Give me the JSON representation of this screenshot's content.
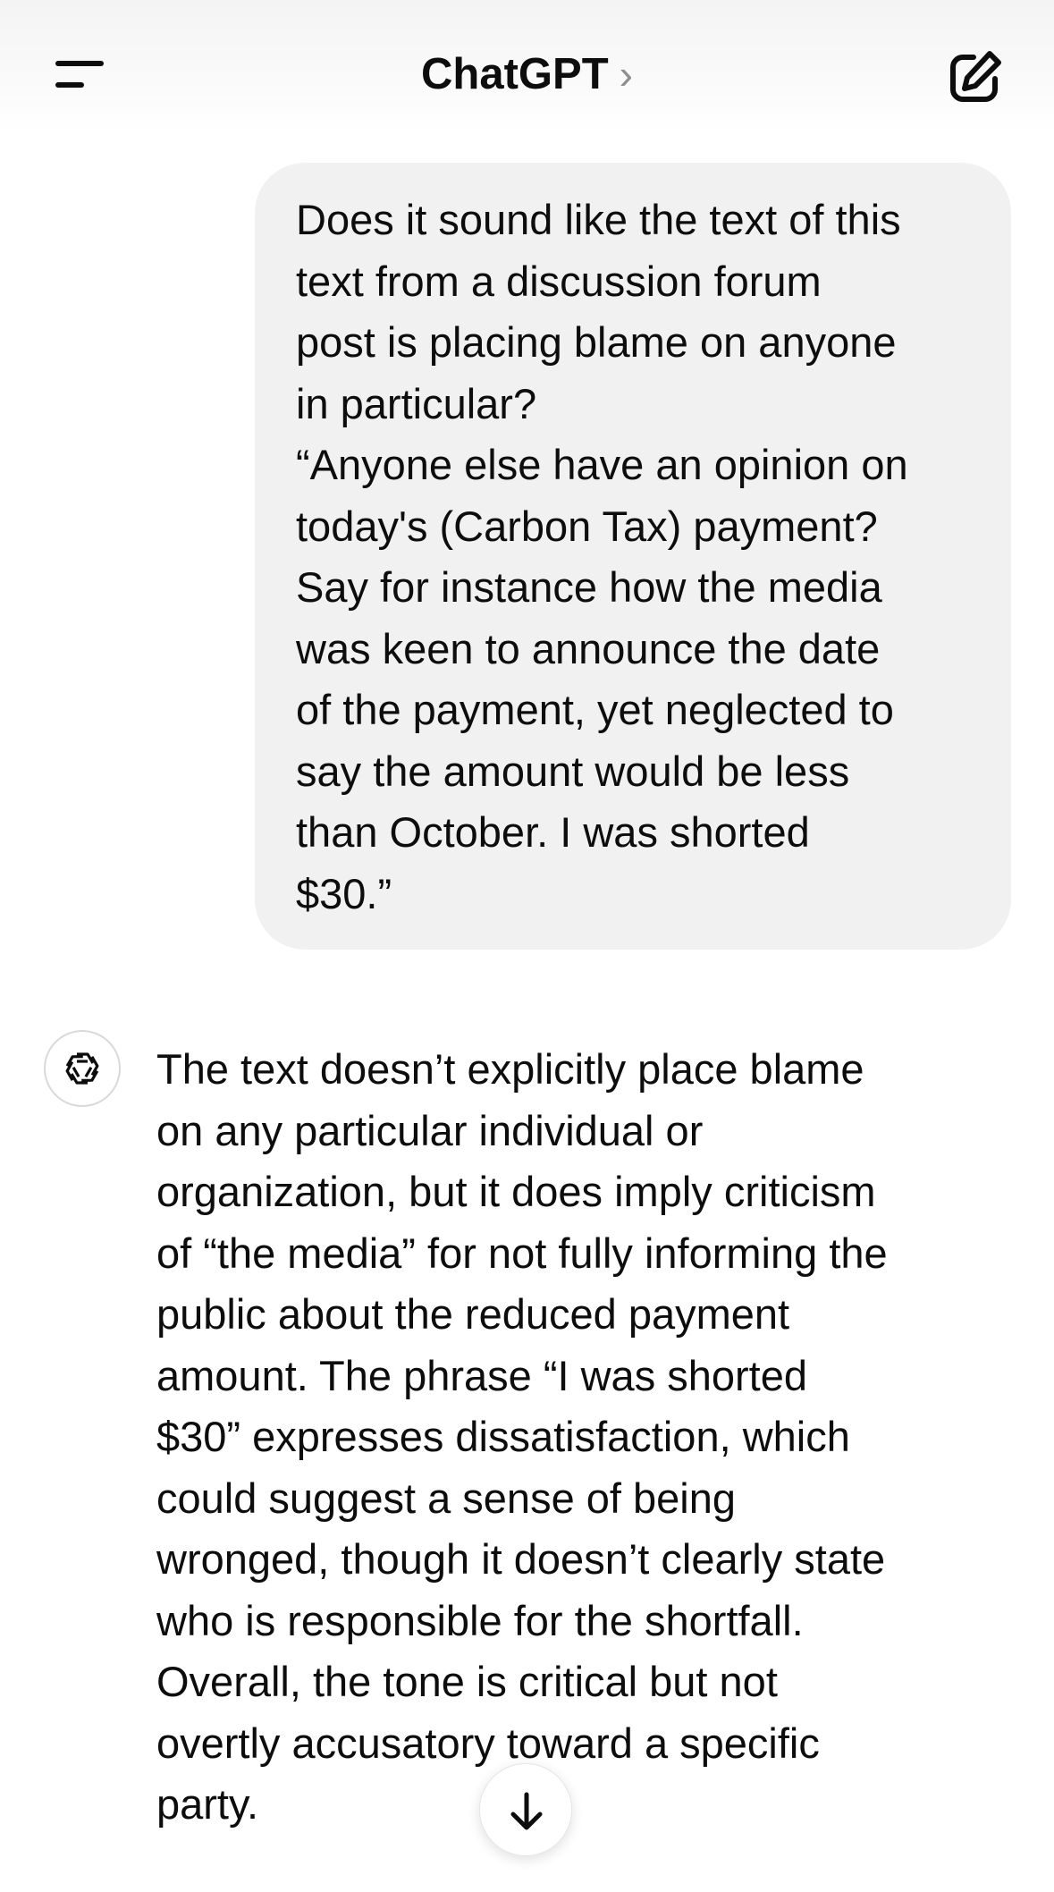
{
  "header": {
    "title": "ChatGPT",
    "chevron": "›",
    "menu_icon": "sidebar-menu-icon",
    "compose_icon": "new-chat-edit-icon"
  },
  "conversation": {
    "user_message": "Does it sound like the text of this\ntext from a discussion forum\npost is placing blame on anyone\nin particular?\n“Anyone else have an opinion on\ntoday's (Carbon Tax) payment?\nSay for instance how the media\nwas keen to announce the date\nof the payment, yet neglected to\nsay the amount would be less\nthan October. I was shorted\n$30.”",
    "assistant_avatar_icon": "openai-logo-icon",
    "assistant_message": "The text doesn’t explicitly place blame\non any particular individual or\norganization, but it does imply criticism\nof “the media” for not fully informing the\npublic about the reduced payment\namount. The phrase “I was shorted\n$30” expresses dissatisfaction, which\ncould suggest a sense of being\nwronged, though it doesn’t clearly state\nwho is responsible for the shortfall.\nOverall, the tone is critical but not\novertly accusatory toward a specific\nparty."
  },
  "scroll_button": {
    "icon": "arrow-down-icon"
  },
  "colors": {
    "text": "#0d0d0d",
    "user_bubble": "#f1f1f1",
    "chevron": "#8e8e8e",
    "background": "#ffffff"
  }
}
